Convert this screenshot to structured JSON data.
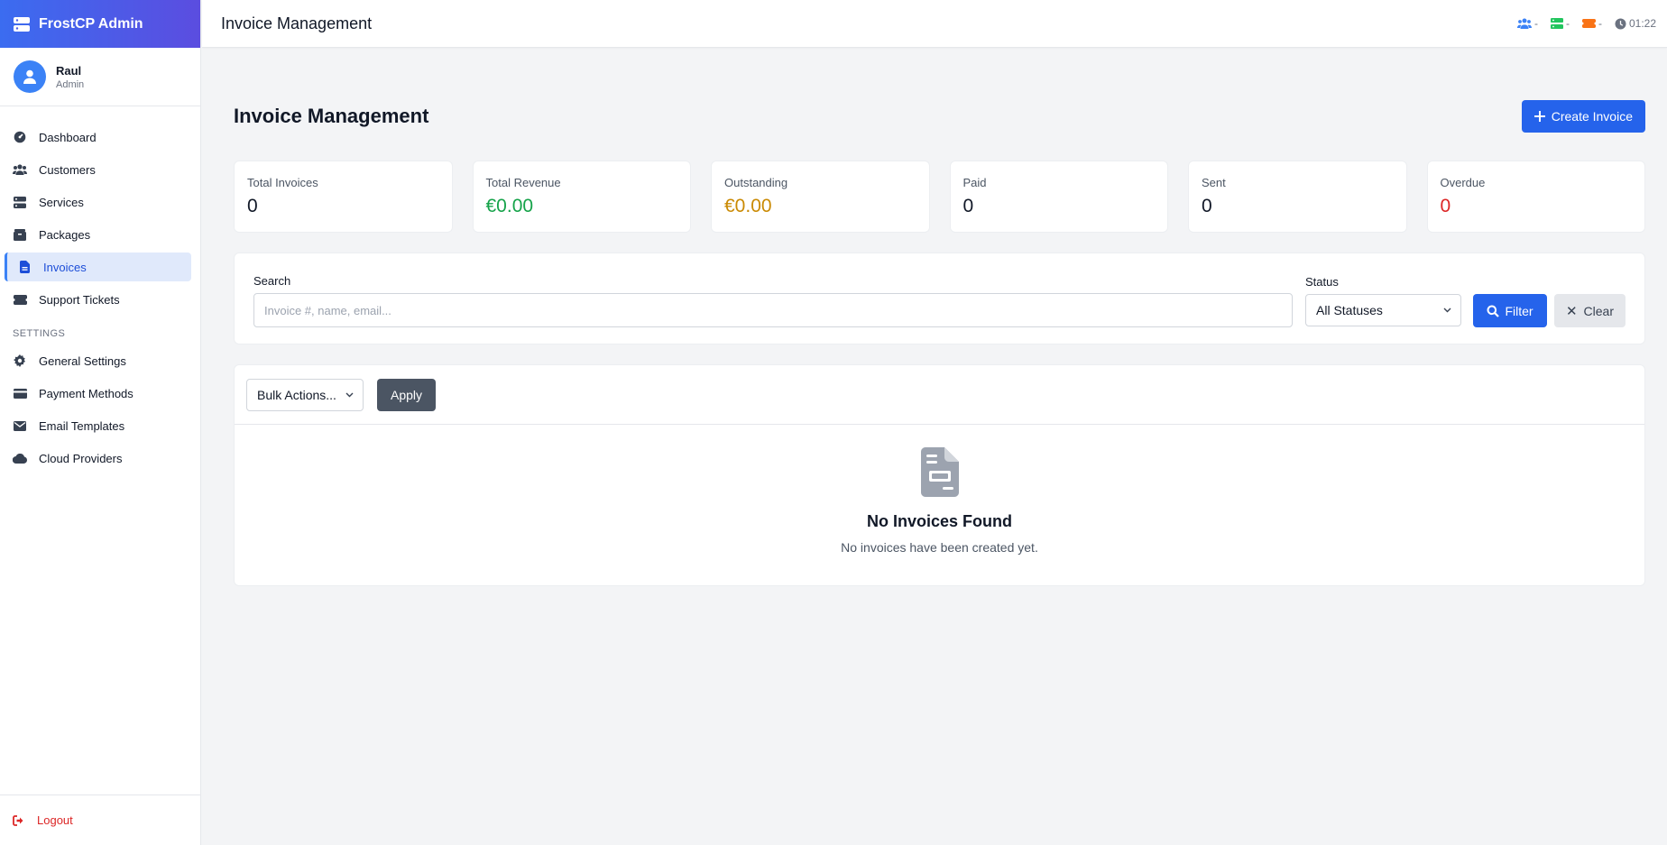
{
  "brand": {
    "name": "FrostCP Admin"
  },
  "user": {
    "name": "Raul",
    "role": "Admin"
  },
  "nav": {
    "items": [
      {
        "label": "Dashboard",
        "icon": "dashboard-icon"
      },
      {
        "label": "Customers",
        "icon": "users-icon"
      },
      {
        "label": "Services",
        "icon": "server-icon"
      },
      {
        "label": "Packages",
        "icon": "box-icon"
      },
      {
        "label": "Invoices",
        "icon": "invoice-icon",
        "active": true
      },
      {
        "label": "Support Tickets",
        "icon": "ticket-icon"
      }
    ],
    "settings_heading": "SETTINGS",
    "settings_items": [
      {
        "label": "General Settings",
        "icon": "gear-icon"
      },
      {
        "label": "Payment Methods",
        "icon": "credit-card-icon"
      },
      {
        "label": "Email Templates",
        "icon": "envelope-icon"
      },
      {
        "label": "Cloud Providers",
        "icon": "cloud-icon"
      }
    ],
    "logout": "Logout"
  },
  "topbar": {
    "title": "Invoice Management",
    "status": {
      "users": "-",
      "servers": "-",
      "tickets": "-",
      "time": "01:22"
    }
  },
  "page": {
    "title": "Invoice Management",
    "create_button": "Create Invoice"
  },
  "stats": [
    {
      "label": "Total Invoices",
      "value": "0"
    },
    {
      "label": "Total Revenue",
      "value": "€0.00"
    },
    {
      "label": "Outstanding",
      "value": "€0.00"
    },
    {
      "label": "Paid",
      "value": "0"
    },
    {
      "label": "Sent",
      "value": "0"
    },
    {
      "label": "Overdue",
      "value": "0"
    }
  ],
  "filters": {
    "search_label": "Search",
    "search_placeholder": "Invoice #, name, email...",
    "status_label": "Status",
    "status_value": "All Statuses",
    "filter_button": "Filter",
    "clear_button": "Clear"
  },
  "list": {
    "bulk_actions": "Bulk Actions...",
    "apply_button": "Apply",
    "empty_title": "No Invoices Found",
    "empty_message": "No invoices have been created yet."
  },
  "colors": {
    "accent": "#2563eb",
    "success": "#16a34a",
    "warning": "#ca8a04",
    "danger": "#dc2626"
  }
}
